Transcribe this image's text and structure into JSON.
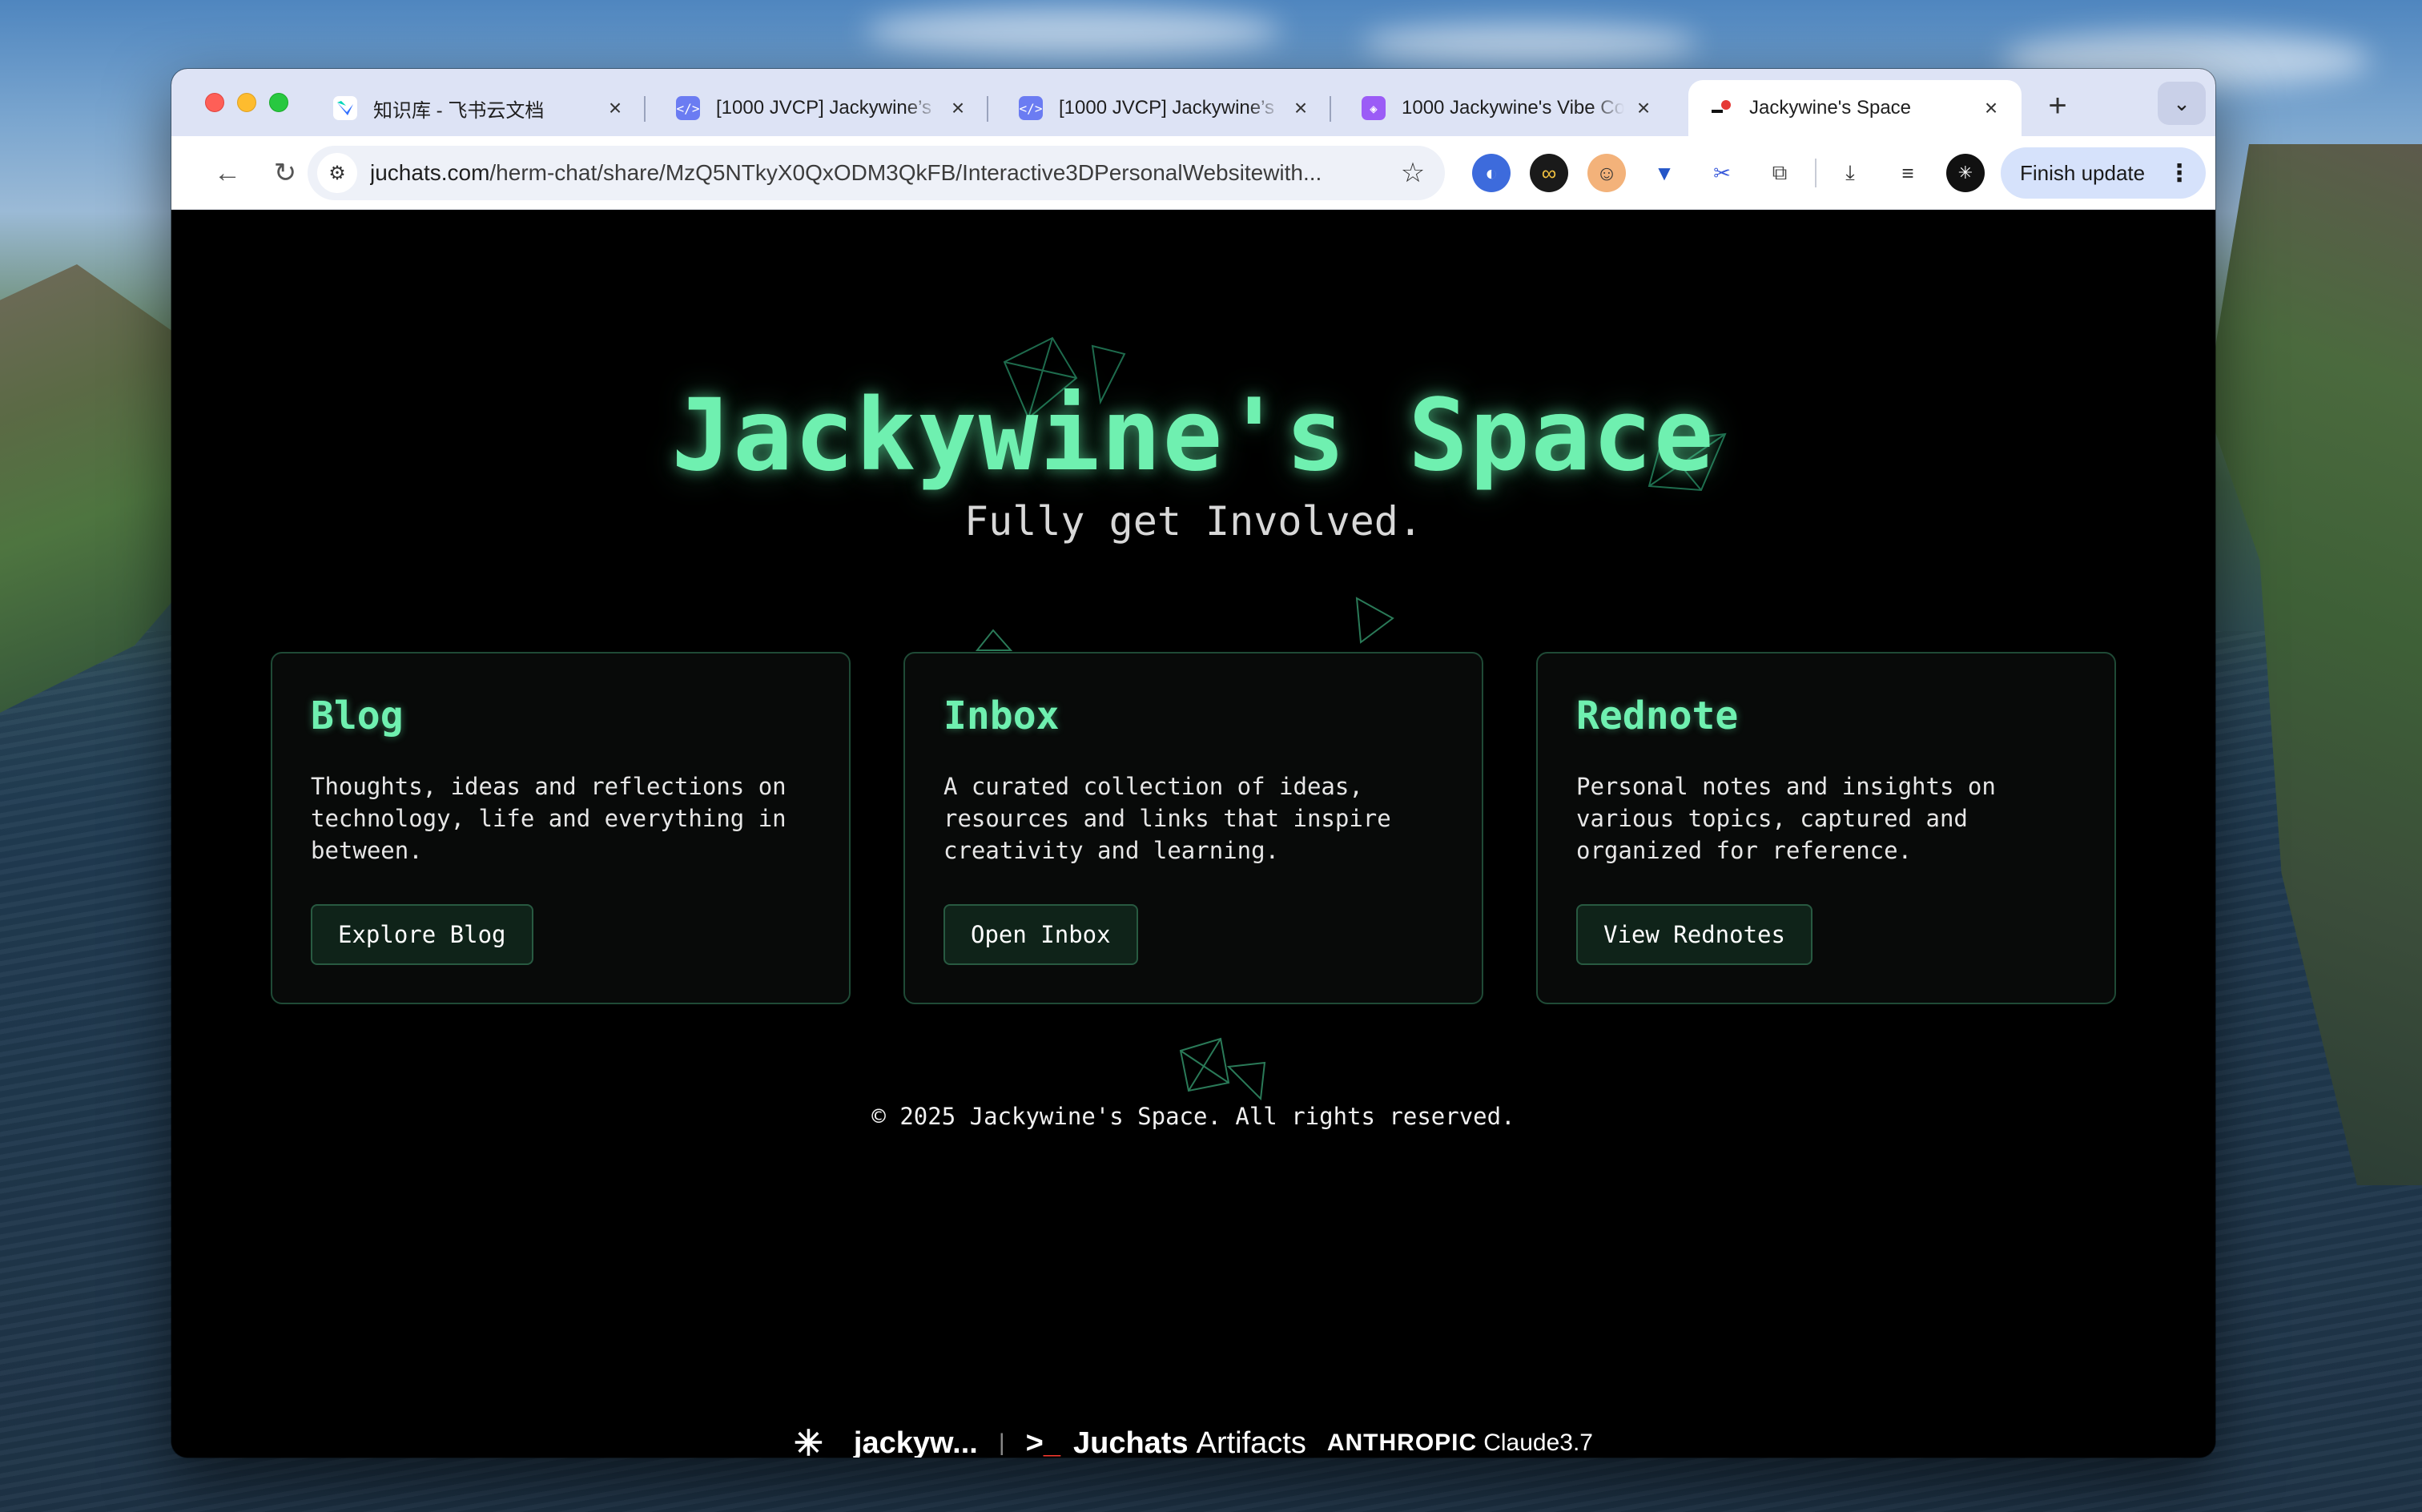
{
  "browser": {
    "tabs": [
      {
        "title": "知识库 - 飞书云文档",
        "favicon": "feishu-icon",
        "active": false
      },
      {
        "title": "[1000 JVCP] Jackywine’s",
        "favicon": "code-icon",
        "active": false
      },
      {
        "title": "[1000 JVCP] Jackywine’s",
        "favicon": "code-icon",
        "active": false
      },
      {
        "title": "1000 Jackywine's Vibe Co",
        "favicon": "app-icon",
        "active": false
      },
      {
        "title": "Jackywine's Space",
        "favicon": "juchats-icon",
        "active": true
      }
    ],
    "url_host": "juchats.com",
    "url_path": "/herm-chat/share/MzQ5NTkyX0QxODM3QkFB/Interactive3DPersonalWebsitewith...",
    "finish_update_label": "Finish update"
  },
  "page": {
    "title": "Jackywine's Space",
    "subtitle": "Fully get Involved.",
    "cards": [
      {
        "heading": "Blog",
        "text": "Thoughts, ideas and reflections on technology, life and everything in between.",
        "button": "Explore Blog"
      },
      {
        "heading": "Inbox",
        "text": "A curated collection of ideas, resources and links that inspire creativity and learning.",
        "button": "Open Inbox"
      },
      {
        "heading": "Rednote",
        "text": "Personal notes and insights on various topics, captured and organized for reference.",
        "button": "View Rednotes"
      }
    ],
    "copyright": "© 2025 Jackywine's Space. All rights reserved."
  },
  "footer_badge": {
    "user": "jackyw...",
    "separator": "|",
    "brand": "Juchats",
    "artifacts": "Artifacts",
    "provider": "ANTHROPIC",
    "model": "Claude3.7"
  },
  "colors": {
    "accent_green": "#6ff0b0",
    "card_border": "#1f4a36",
    "button_bg": "#0f2319",
    "tabstrip_bg": "#dde3f5"
  }
}
